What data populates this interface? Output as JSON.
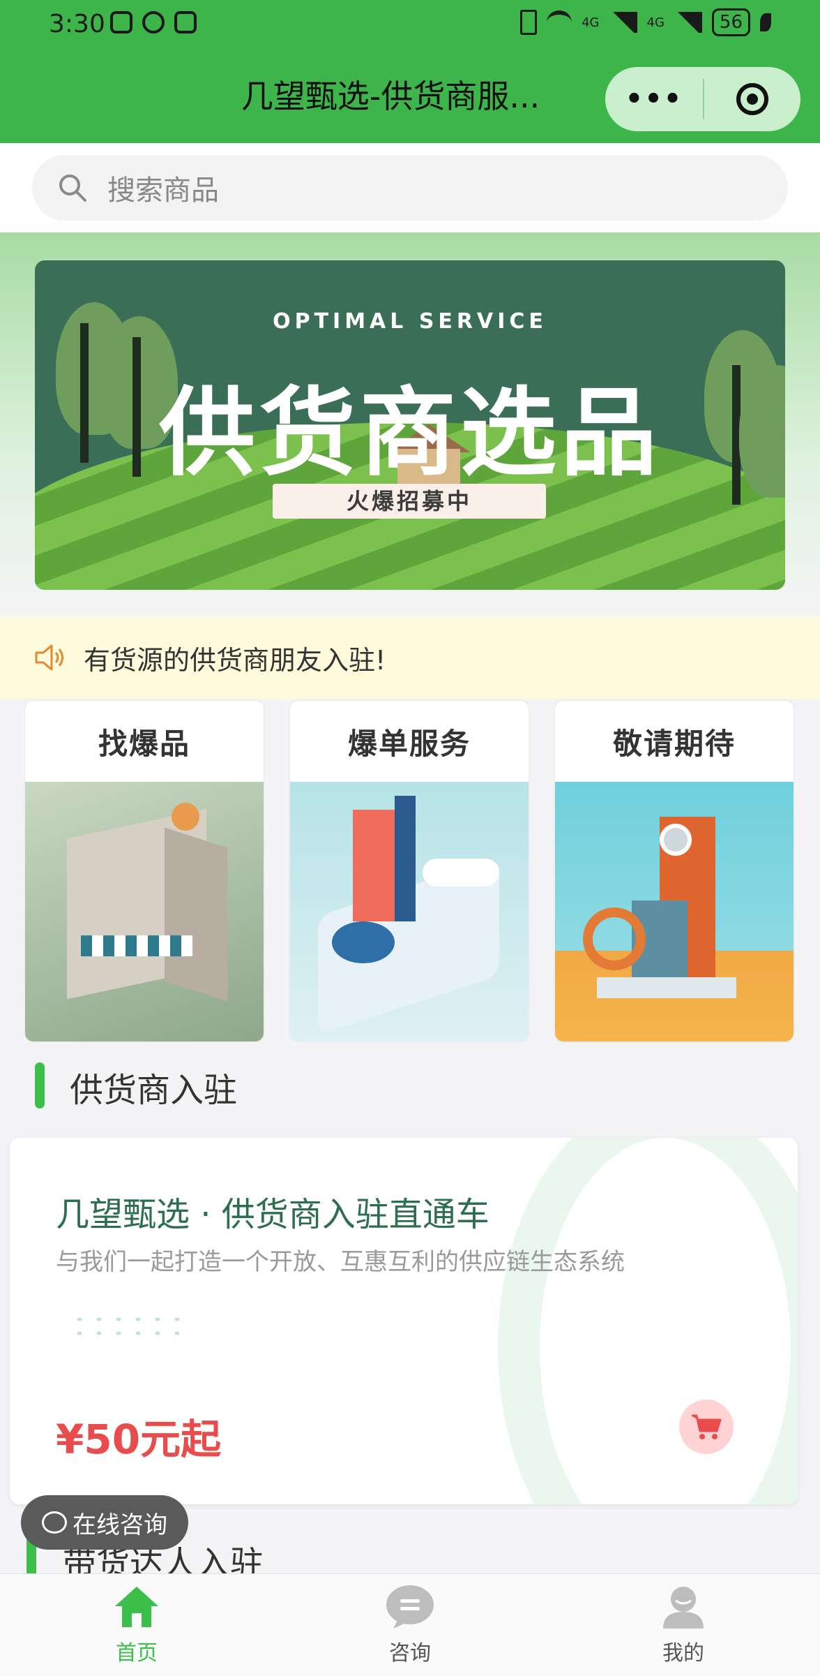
{
  "status_bar": {
    "time": "3:30",
    "battery": "56",
    "net1": "4G",
    "net2": "4G"
  },
  "header": {
    "title": "几望甄选-供货商服...",
    "more_label": "•••"
  },
  "search": {
    "placeholder": "搜索商品"
  },
  "banner": {
    "en_text": "OPTIMAL  SERVICE",
    "zh_text": "供货商选品",
    "tag_text": "火爆招募中"
  },
  "notice": {
    "text": "有货源的供货商朋友入驻!"
  },
  "categories": [
    {
      "label": "找爆品"
    },
    {
      "label": "爆单服务"
    },
    {
      "label": "敬请期待"
    }
  ],
  "section_supplier": {
    "title": "供货商入驻"
  },
  "supplier_card": {
    "title": "几望甄选 · 供货商入驻直通车",
    "subtitle": "与我们一起打造一个开放、互惠互利的供应链生态系统",
    "price": "¥50元起"
  },
  "section_talent": {
    "title": "带货达人入驻"
  },
  "consult": {
    "label": "在线咨询"
  },
  "tabbar": {
    "items": [
      {
        "label": "首页",
        "icon": "home-icon",
        "active": true
      },
      {
        "label": "咨询",
        "icon": "chat-icon",
        "active": false
      },
      {
        "label": "我的",
        "icon": "user-icon",
        "active": false
      }
    ]
  },
  "colors": {
    "brand": "#3db54a",
    "price": "#e84c4c",
    "notice_bg": "#fdfbdc"
  }
}
